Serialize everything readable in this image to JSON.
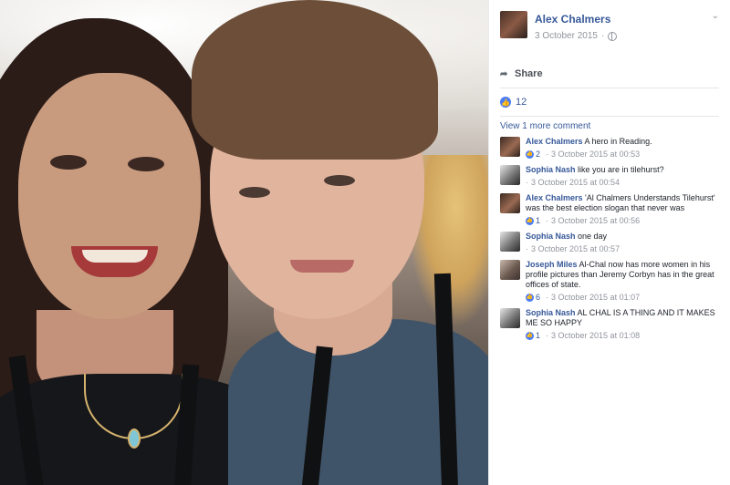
{
  "post": {
    "author": "Alex Chalmers",
    "date": "3 October 2015",
    "separator": "·"
  },
  "actions": {
    "share_label": "Share"
  },
  "likes": {
    "count": "12"
  },
  "comments_section": {
    "view_more_label": "View 1 more comment"
  },
  "comments": [
    {
      "author": "Alex Chalmers",
      "text": "A hero in Reading.",
      "likes": "2",
      "timestamp": "3 October 2015 at 00:53"
    },
    {
      "author": "Sophia Nash",
      "text": "like you are in tilehurst?",
      "likes": "",
      "timestamp": "3 October 2015 at 00:54"
    },
    {
      "author": "Alex Chalmers",
      "text": "'Al Chalmers Understands Tilehurst' was the best election slogan that never was",
      "likes": "1",
      "timestamp": "3 October 2015 at 00:56"
    },
    {
      "author": "Sophia Nash",
      "text": "one day",
      "likes": "",
      "timestamp": "3 October 2015 at 00:57"
    },
    {
      "author": "Joseph Miles",
      "text": "Al-Chal now has more women in his profile pictures than Jeremy Corbyn has in the great offices of state.",
      "likes": "6",
      "timestamp": "3 October 2015 at 01:07"
    },
    {
      "author": "Sophia Nash",
      "text": "AL CHAL IS A THING AND IT MAKES ME SO HAPPY",
      "likes": "1",
      "timestamp": "3 October 2015 at 01:08"
    }
  ],
  "colors": {
    "link": "#365899",
    "meta": "#90949c",
    "like_blue": "#4a7cf7"
  },
  "icons": [
    "globe-icon",
    "chevron-down-icon",
    "share-icon",
    "like-icon"
  ]
}
